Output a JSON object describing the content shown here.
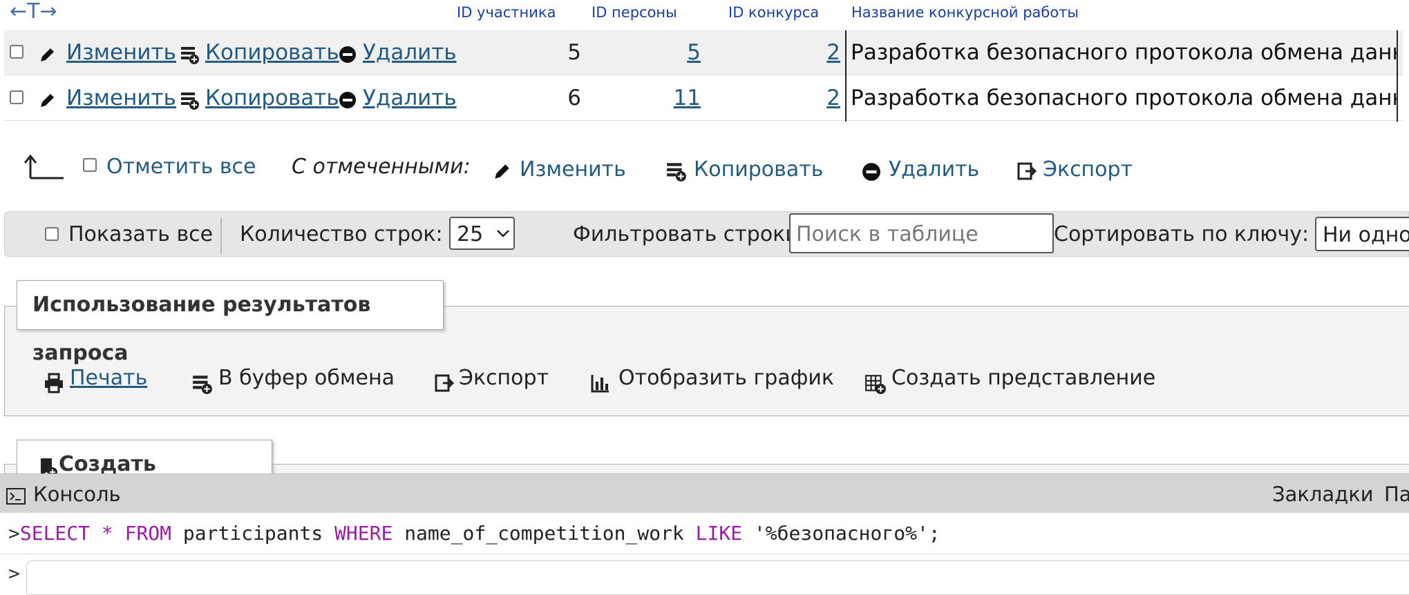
{
  "nav_arrows": "←T→",
  "columns": [
    "ID участника",
    "ID персоны",
    "ID конкурса",
    "Название конкурсной работы"
  ],
  "row_actions": {
    "edit": "Изменить",
    "copy": "Копировать",
    "delete": "Удалить"
  },
  "rows": [
    {
      "participant_id": "5",
      "person_id": "5",
      "competition_id": "2",
      "work_name": "Разработка безопасного протокола обмена данными"
    },
    {
      "participant_id": "6",
      "person_id": "11",
      "competition_id": "2",
      "work_name": "Разработка безопасного протокола обмена данными"
    }
  ],
  "bulk": {
    "select_all": "Отметить все",
    "with_selected": "С отмеченными:",
    "edit": "Изменить",
    "copy": "Копировать",
    "delete": "Удалить",
    "export": "Экспорт"
  },
  "nav_toolbar": {
    "show_all": "Показать все",
    "rows_count_label": "Количество строк:",
    "rows_count_value": "25",
    "filter_label": "Фильтровать строки:",
    "filter_placeholder": "Поиск в таблице",
    "sort_label": "Сортировать по ключу:",
    "sort_value": "Ни одно"
  },
  "query_results": {
    "legend": "Использование результатов запроса",
    "print": "Печать",
    "clipboard": "В буфер обмена",
    "export": "Экспорт",
    "chart": "Отобразить график",
    "create_view": "Создать представление"
  },
  "bookmark": {
    "legend": "Создать закладку"
  },
  "console": {
    "title": "Консоль",
    "bookmarks_tab": "Закладки",
    "next_tab": "Па",
    "prompt": ">",
    "sql": {
      "select": "SELECT",
      "star": "*",
      "from": "FROM",
      "table": "participants",
      "where": "WHERE",
      "column": "name_of_competition_work",
      "like": "LIKE",
      "value": "'%безопасного%';"
    }
  },
  "colors": {
    "link": "#235a81",
    "keyword": "#9a1ba6",
    "header": "#1a3d9e"
  }
}
